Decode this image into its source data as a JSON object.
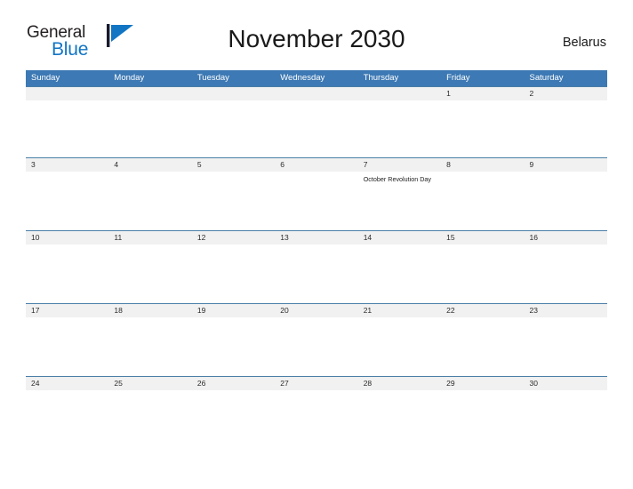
{
  "brand": {
    "name_part1": "General",
    "name_part2": "Blue",
    "flag_icon": "flag-triangle-icon",
    "colors": {
      "general_text": "#231f20",
      "blue_text": "#1275c4",
      "flag_blue": "#1275c4",
      "flag_pole": "#1a1a2e"
    }
  },
  "header": {
    "title": "November 2030",
    "country": "Belarus"
  },
  "theme": {
    "header_row_bg": "#3d79b4",
    "header_row_text": "#ffffff",
    "date_band_bg": "#f1f1f1",
    "week_separator": "#4a7ea8",
    "page_bg": "#ffffff",
    "date_text": "#2b2b2b",
    "event_text": "#1d1d1d"
  },
  "calendar": {
    "day_headers": [
      "Sunday",
      "Monday",
      "Tuesday",
      "Wednesday",
      "Thursday",
      "Friday",
      "Saturday"
    ],
    "weeks": [
      {
        "dates": [
          "",
          "",
          "",
          "",
          "",
          "1",
          "2"
        ],
        "events": [
          "",
          "",
          "",
          "",
          "",
          "",
          ""
        ]
      },
      {
        "dates": [
          "3",
          "4",
          "5",
          "6",
          "7",
          "8",
          "9"
        ],
        "events": [
          "",
          "",
          "",
          "",
          "October Revolution Day",
          "",
          ""
        ]
      },
      {
        "dates": [
          "10",
          "11",
          "12",
          "13",
          "14",
          "15",
          "16"
        ],
        "events": [
          "",
          "",
          "",
          "",
          "",
          "",
          ""
        ]
      },
      {
        "dates": [
          "17",
          "18",
          "19",
          "20",
          "21",
          "22",
          "23"
        ],
        "events": [
          "",
          "",
          "",
          "",
          "",
          "",
          ""
        ]
      },
      {
        "dates": [
          "24",
          "25",
          "26",
          "27",
          "28",
          "29",
          "30"
        ],
        "events": [
          "",
          "",
          "",
          "",
          "",
          "",
          ""
        ]
      }
    ]
  }
}
